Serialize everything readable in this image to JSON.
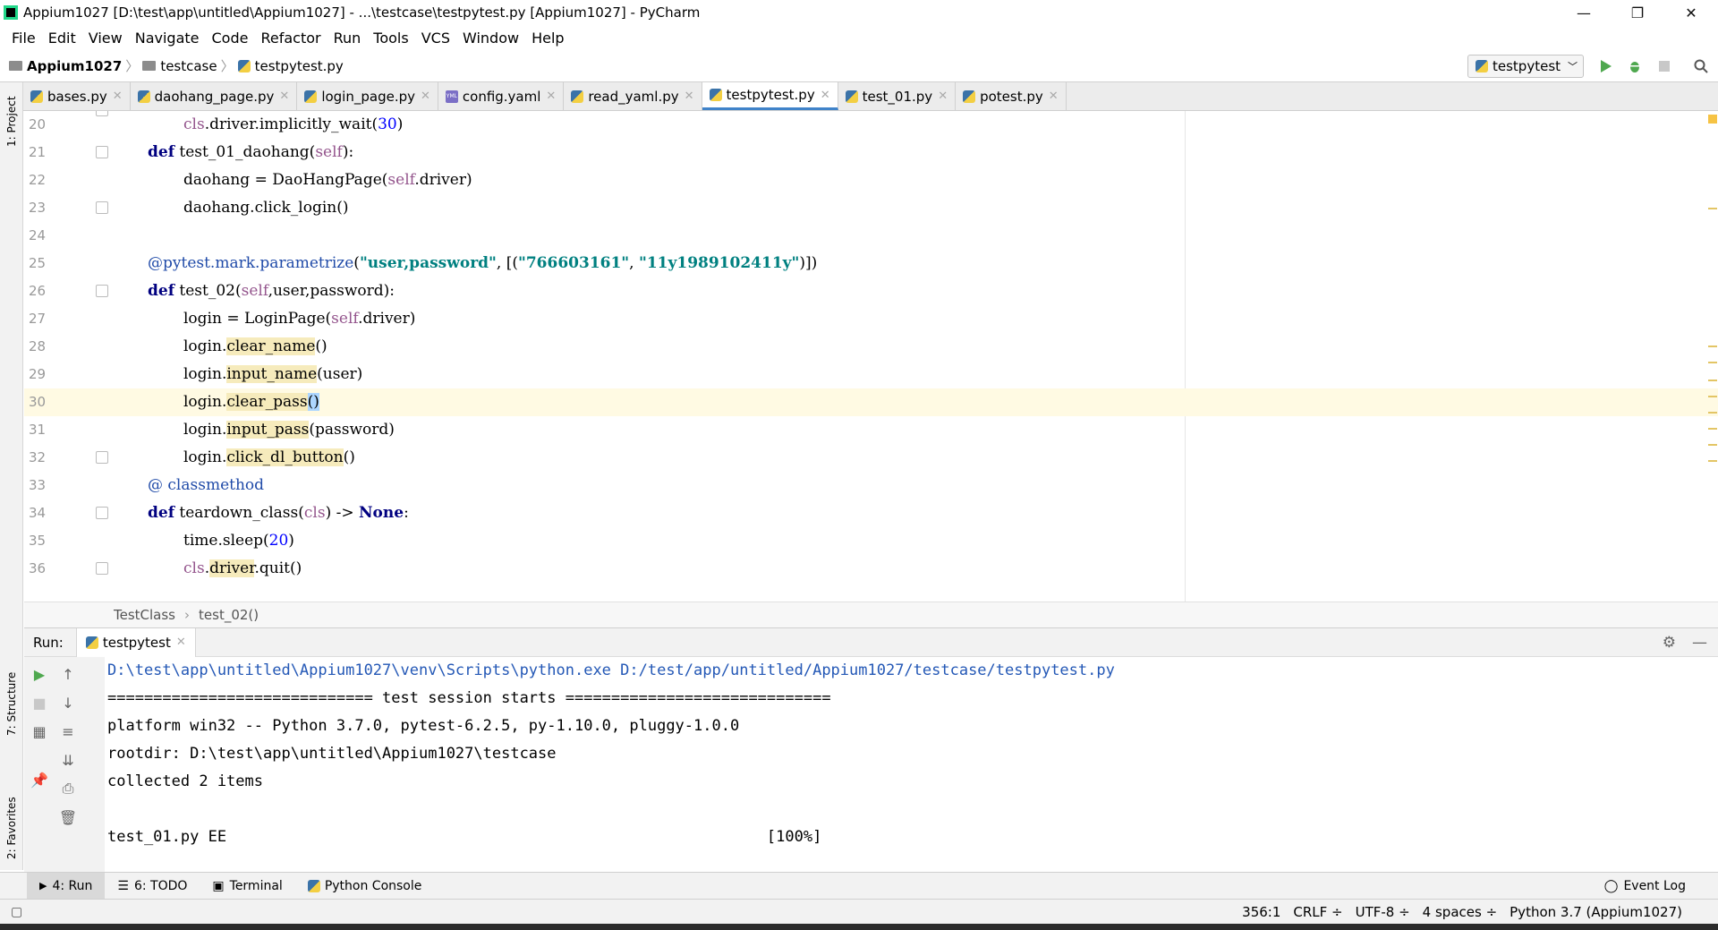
{
  "window": {
    "title": "Appium1027 [D:\\test\\app\\untitled\\Appium1027] - ...\\testcase\\testpytest.py [Appium1027] - PyCharm",
    "minimize": "—",
    "restore": "❐",
    "close": "✕"
  },
  "menu": [
    "File",
    "Edit",
    "View",
    "Navigate",
    "Code",
    "Refactor",
    "Run",
    "Tools",
    "VCS",
    "Window",
    "Help"
  ],
  "navbar": {
    "project": "Appium1027",
    "folder": "testcase",
    "file": "testpytest.py",
    "run_config": "testpytest"
  },
  "tabs": [
    {
      "label": "bases.py",
      "icon": "python-icon"
    },
    {
      "label": "daohang_page.py",
      "icon": "python-icon"
    },
    {
      "label": "login_page.py",
      "icon": "python-icon"
    },
    {
      "label": "config.yaml",
      "icon": "yaml-icon"
    },
    {
      "label": "read_yaml.py",
      "icon": "python-icon"
    },
    {
      "label": "testpytest.py",
      "icon": "python-icon",
      "active": true
    },
    {
      "label": "test_01.py",
      "icon": "python-icon"
    },
    {
      "label": "potest.py",
      "icon": "python-icon"
    }
  ],
  "left_stripe": {
    "project": "1: Project",
    "structure": "7: Structure",
    "favorites": "2: Favorites"
  },
  "editor": {
    "line_numbers": [
      "20",
      "21",
      "22",
      "23",
      "24",
      "25",
      "26",
      "27",
      "28",
      "29",
      "30",
      "31",
      "32",
      "33",
      "34",
      "35",
      "36"
    ],
    "current_line": "30"
  },
  "breadcrumb": {
    "class": "TestClass",
    "method": "test_02()"
  },
  "run": {
    "label": "Run:",
    "tab": "testpytest",
    "console": [
      "D:\\test\\app\\untitled\\Appium1027\\venv\\Scripts\\python.exe D:/test/app/untitled/Appium1027/testcase/testpytest.py",
      "============================= test session starts =============================",
      "platform win32 -- Python 3.7.0, pytest-6.2.5, py-1.10.0, pluggy-1.0.0",
      "rootdir: D:\\test\\app\\untitled\\Appium1027\\testcase",
      "collected 2 items",
      "",
      "test_01.py EE                                                           [100%]"
    ]
  },
  "bottom_tools": {
    "run": "4: Run",
    "todo": "6: TODO",
    "terminal": "Terminal",
    "python_console": "Python Console",
    "event_log": "Event Log"
  },
  "status": {
    "position": "356:1",
    "line_sep": "CRLF ÷",
    "encoding": "UTF-8 ÷",
    "indent": "4 spaces ÷",
    "interpreter": "Python 3.7 (Appium1027)"
  }
}
